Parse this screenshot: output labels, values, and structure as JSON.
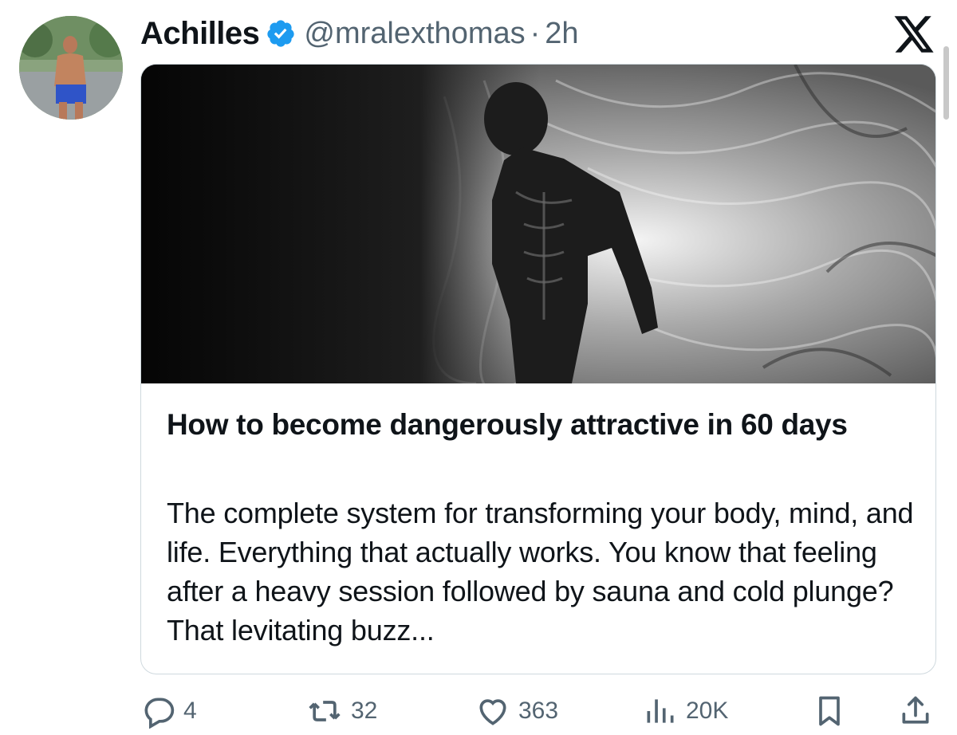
{
  "tweet": {
    "author": {
      "display_name": "Achilles",
      "handle": "@mralexthomas",
      "verified": true,
      "avatar_icon": "profile-photo"
    },
    "separator": "·",
    "timestamp": "2h",
    "brand_icon": "x-logo-icon"
  },
  "card": {
    "image_icon": "statue-artwork-image",
    "title": "How to become dangerously attractive in 60 days",
    "description": "The complete system for transforming your body, mind, and life. Everything that actually works. You know that feeling after a heavy session followed by sauna and cold plunge? That levitating buzz..."
  },
  "actions": {
    "reply_count": "4",
    "repost_count": "32",
    "like_count": "363",
    "view_count": "20K",
    "bookmark_icon": "bookmark-icon",
    "share_icon": "share-icon"
  },
  "colors": {
    "text_primary": "#0f1419",
    "text_secondary": "#536471",
    "verified_blue": "#1d9bf0",
    "card_border": "#cfd9de"
  }
}
